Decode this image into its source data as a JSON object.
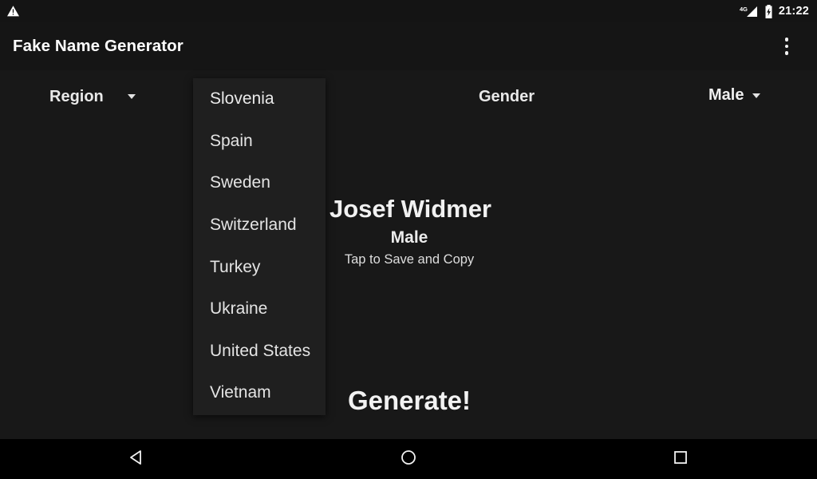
{
  "status_bar": {
    "left_icons": [
      {
        "name": "warning-triangle-icon",
        "glyph": "warning"
      }
    ],
    "right_icons": [
      {
        "name": "mobile-signal-4g-icon",
        "label": "4G"
      },
      {
        "name": "battery-charging-icon",
        "glyph": "charging"
      }
    ],
    "clock": "21:22",
    "background": "#141414"
  },
  "app_bar": {
    "title": "Fake Name Generator",
    "overflow_menu": {
      "name": "overflow-menu-icon",
      "dots": 3
    },
    "background": "#151515",
    "text_color": "#ffffff"
  },
  "main": {
    "background": "#181818",
    "region": {
      "label": "Region",
      "selected": "Slovenia",
      "expanded": true,
      "options": [
        "Slovenia",
        "Spain",
        "Sweden",
        "Switzerland",
        "Turkey",
        "Ukraine",
        "United States",
        "Vietnam"
      ],
      "dropdown_background": "#1f1f1f"
    },
    "gender": {
      "label": "Gender",
      "selected": "Male",
      "expanded": false
    },
    "result": {
      "name": "Josef Widmer",
      "gender": "Male",
      "hint": "Tap to Save and Copy"
    },
    "generate_button": {
      "label": "Generate!"
    }
  },
  "nav_bar": {
    "background": "#000000",
    "buttons": [
      {
        "name": "nav-back-button",
        "icon": "back-triangle-icon"
      },
      {
        "name": "nav-home-button",
        "icon": "home-circle-icon"
      },
      {
        "name": "nav-recents-button",
        "icon": "recents-square-icon"
      }
    ]
  }
}
